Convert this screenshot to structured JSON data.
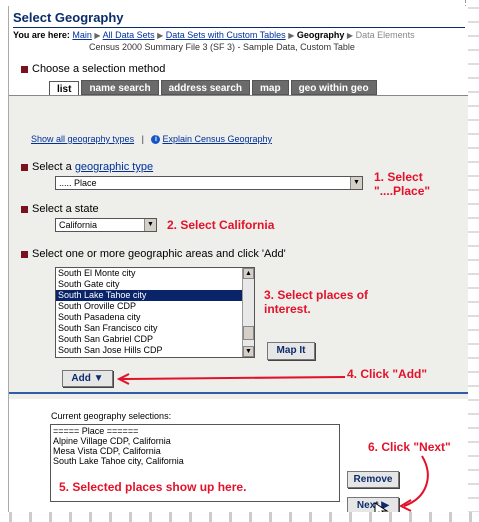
{
  "page": {
    "title": "Select Geography",
    "breadcrumb": {
      "prefix": "You are here:",
      "items": [
        "Main",
        "All Data Sets",
        "Data Sets with Custom Tables",
        "Geography",
        "Data Elements"
      ],
      "current": "Geography"
    },
    "subtitle": "Census 2000 Summary File 3 (SF 3) - Sample Data, Custom Table"
  },
  "method": {
    "label": "Choose a selection method",
    "tabs": [
      "list",
      "name search",
      "address search",
      "map",
      "geo within geo"
    ],
    "active_tab": "list"
  },
  "links": {
    "show_all": "Show all geography types",
    "separator": "|",
    "explain": "Explain Census Geography",
    "explain_icon": "info-icon"
  },
  "geo_type": {
    "label_prefix": "Select a",
    "label_link": "geographic type",
    "value": "..... Place"
  },
  "state": {
    "label": "Select a state",
    "value": "California"
  },
  "areas": {
    "label": "Select one or more geographic areas and click 'Add'",
    "items": [
      "South El Monte city",
      "South Gate city",
      "South Lake Tahoe city",
      "South Oroville CDP",
      "South Pasadena city",
      "South San Francisco city",
      "South San Gabriel CDP",
      "South San Jose Hills CDP"
    ],
    "selected_index": 2
  },
  "buttons": {
    "map_it": "Map It",
    "add": "Add",
    "remove": "Remove",
    "next": "Next"
  },
  "current": {
    "label": "Current geography selections:",
    "items": [
      "===== Place ======",
      "Alpine Village CDP, California",
      "Mesa Vista CDP, California",
      "South Lake Tahoe city, California"
    ]
  },
  "annotations": {
    "a1": "1. Select\n\"....Place\"",
    "a2": "2. Select California",
    "a3": "3. Select places of\ninterest.",
    "a4": "4. Click \"Add\"",
    "a5": "5. Selected places show up here.",
    "a6": "6. Click \"Next\""
  },
  "colors": {
    "annotation": "#e3122b",
    "title": "#0b2c6b",
    "link": "#00309c",
    "tab_inactive": "#6b6b6b",
    "bullet": "#7a1020",
    "selection": "#0a246a"
  }
}
